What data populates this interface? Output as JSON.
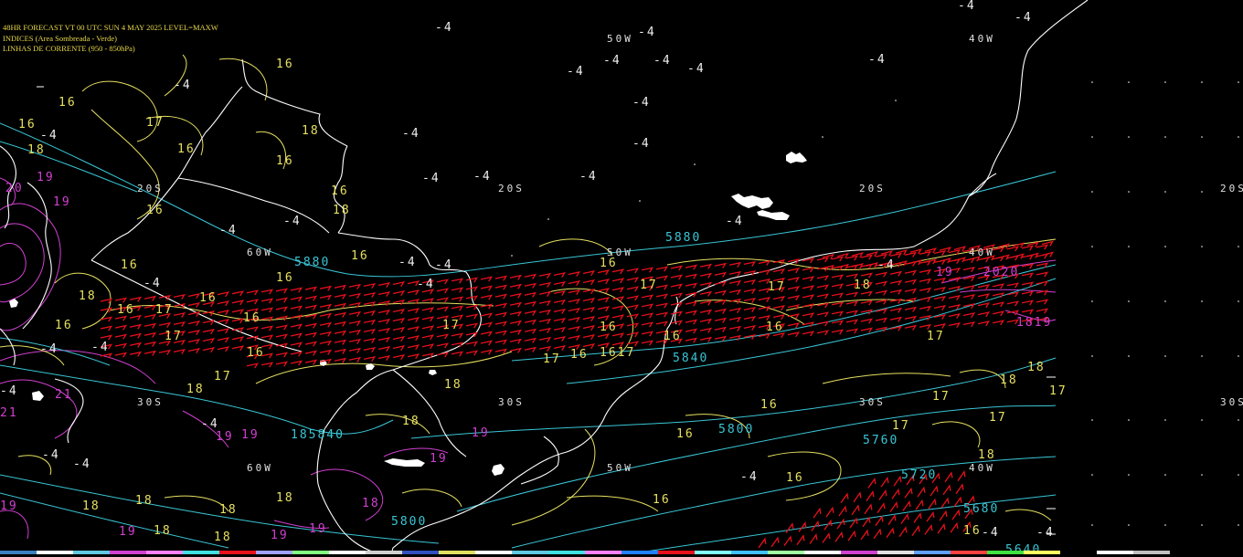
{
  "header": {
    "line1": "48HR FORECAST   VT 00 UTC SUN  4 MAY 2025   LEVEL=MAXW",
    "line2": "INDICES (Area Sombreada - Verde)",
    "line3": "LINHAS DE CORRENTE (950 - 850hPa)"
  },
  "grid_labels": {
    "lat20_a": "20S",
    "lat20_b": "20S",
    "lat20_c": "20S",
    "lat20_d": "20S",
    "lat30_a": "30S",
    "lat30_b": "30S",
    "lat30_c": "30S",
    "lat30_d": "30S",
    "lon50_a": "50W",
    "lon50_b": "50W",
    "lon50_c": "50W",
    "lon40_a": "40W",
    "lon40_b": "40W",
    "lon40_c": "40W",
    "lon60_a": "60W",
    "lon60_b": "60W"
  },
  "neg_labels": {
    "value": "-4"
  },
  "index_labels": {
    "v16": "16",
    "v17": "17",
    "v18": "18",
    "v19": "19",
    "v2020": "2020",
    "v1819": "1819",
    "v1617": "1617"
  },
  "height_labels": {
    "h5880": "5880",
    "h5840": "5840",
    "h5800": "5800",
    "h5760": "5760",
    "h5720": "5720",
    "h5680": "5680",
    "h185840": "185840",
    "h5640": "5640"
  },
  "colors": {
    "coast": "#ffffff",
    "streamline": "#e6e060",
    "height": "#39c6d6",
    "index": "#d040d0",
    "wind": "#e8101a",
    "grid_dots": "#ffffff",
    "background": "#000000"
  }
}
